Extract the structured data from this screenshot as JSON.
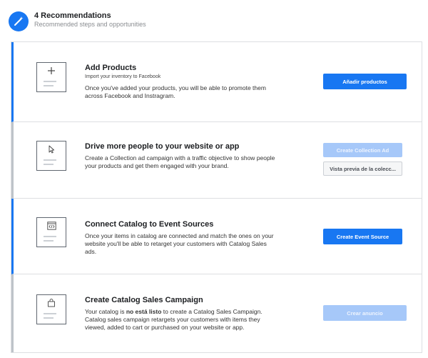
{
  "header": {
    "title": "4 Recommendations",
    "subtitle": "Recommended steps and opportunities",
    "icon": "magic-wand-icon",
    "accent_color": "#1877f2"
  },
  "cards": [
    {
      "title": "Add Products",
      "subtitle": "Import your inventory to Facebook",
      "description": "Once you've added your products, you will be able to promote them across Facebook and Instragram.",
      "icon": "plus-icon",
      "primary_button": "Añadir productos"
    },
    {
      "title": "Drive more people to your website or app",
      "description": "Create a Collection ad campaign with a traffic objective to show people your products and get them engaged with your brand.",
      "icon": "cursor-icon",
      "primary_button": "Create Collection Ad",
      "secondary_button": "Vista previa de la colecc..."
    },
    {
      "title": "Connect Catalog to Event Sources",
      "description": "Once your items in catalog are connected and match the ones on your website you'll be able to retarget your customers with Catalog Sales ads.",
      "icon": "code-window-icon",
      "primary_button": "Create Event Source"
    },
    {
      "title": "Create Catalog Sales Campaign",
      "description_pre": "Your catalog is ",
      "description_bold": "no está listo",
      "description_post": " to create a Catalog Sales Campaign. Catalog sales campaign retargets your customers with items they viewed, added to cart or purchased on your website or app.",
      "icon": "shopping-bag-icon",
      "primary_button": "Crear anuncio"
    }
  ]
}
